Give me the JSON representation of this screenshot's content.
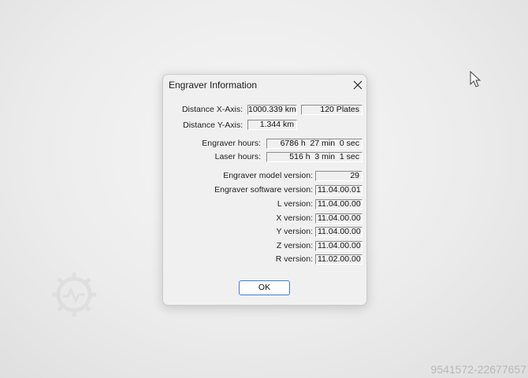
{
  "dialog": {
    "title": "Engraver Information",
    "ok_label": "OK"
  },
  "fields": {
    "distance_x_label": "Distance X-Axis:",
    "distance_x_value": "1000.339 km",
    "plates_value": "120 Plates",
    "distance_y_label": "Distance Y-Axis:",
    "distance_y_value": "1.344 km",
    "engraver_hours_label": "Engraver hours:",
    "engraver_hours_value": "6786 h  27 min  0 sec",
    "laser_hours_label": "Laser hours:",
    "laser_hours_value": "516 h  3 min  1 sec",
    "model_version_label": "Engraver model version:",
    "model_version_value": "29",
    "software_version_label": "Engraver software version:",
    "software_version_value": "11.04.00.01",
    "l_version_label": "L version:",
    "l_version_value": "11.04.00.00",
    "x_version_label": "X version:",
    "x_version_value": "11.04.00.00",
    "y_version_label": "Y version:",
    "y_version_value": "11.04.00.00",
    "z_version_label": "Z version:",
    "z_version_value": "11.04.00.00",
    "r_version_label": "R version:",
    "r_version_value": "11.02.00.00"
  },
  "footer": {
    "stock_id": "9541572-22677657"
  },
  "icons": {
    "close": "close-icon",
    "cursor": "mouse-pointer-icon",
    "watermark": "gear-watermark-icon"
  }
}
